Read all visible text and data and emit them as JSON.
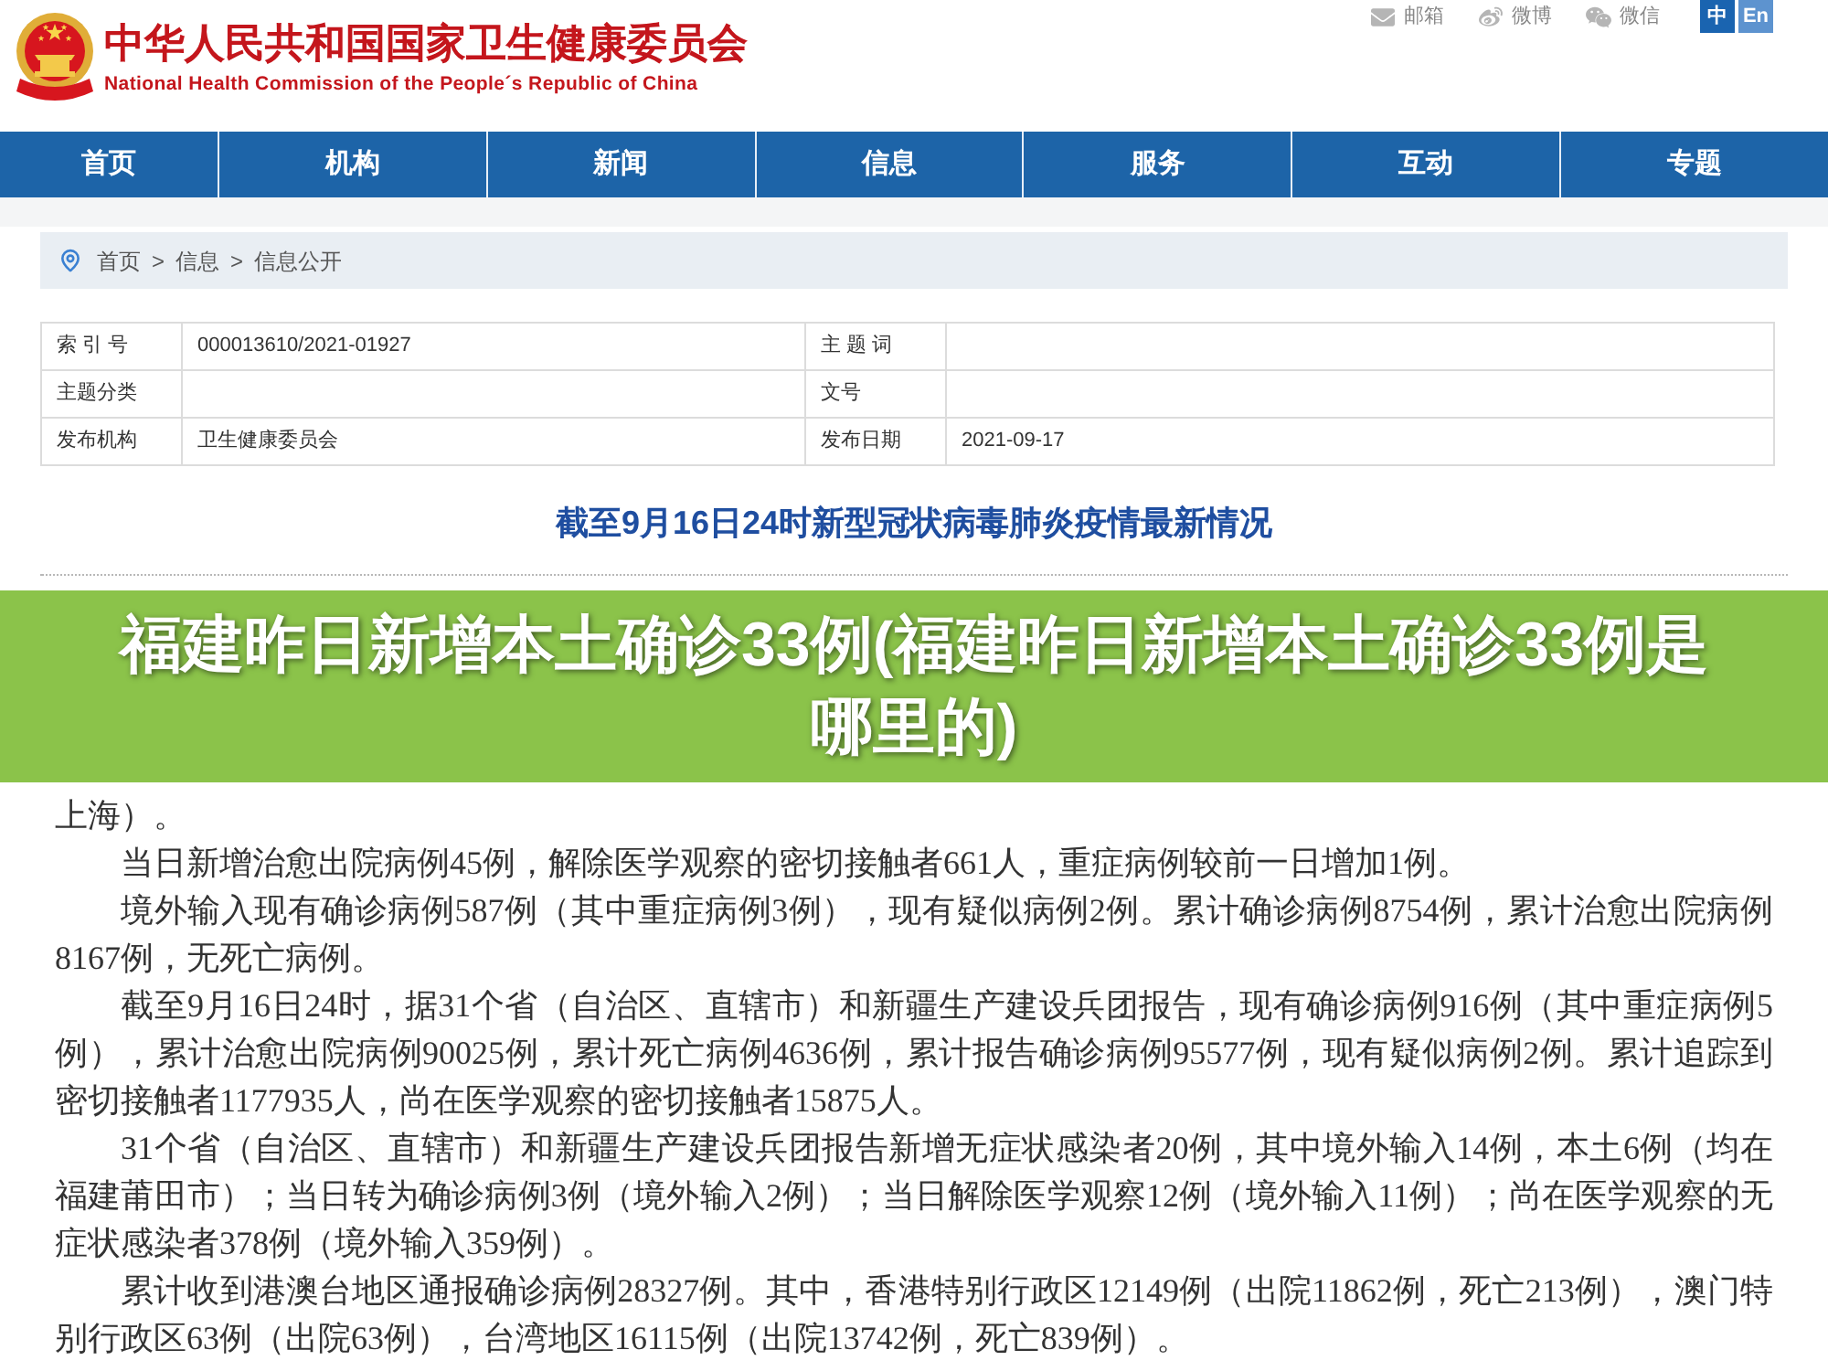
{
  "header": {
    "title": "中华人民共和国国家卫生健康委员会",
    "subtitle": "National Health Commission of the People´s Republic of China",
    "links": [
      {
        "kind": "mail",
        "label": "邮箱"
      },
      {
        "kind": "weibo",
        "label": "微博"
      },
      {
        "kind": "wechat",
        "label": "微信"
      }
    ],
    "languages": [
      {
        "label": "中",
        "selected": true
      },
      {
        "label": "En",
        "selected": false
      }
    ]
  },
  "nav": {
    "items": [
      "首页",
      "机构",
      "新闻",
      "信息",
      "服务",
      "互动",
      "专题"
    ]
  },
  "breadcrumb": {
    "items": [
      {
        "kind": "link",
        "text": "首页"
      },
      {
        "kind": "separator",
        "text": ">"
      },
      {
        "kind": "link",
        "text": "信息"
      },
      {
        "kind": "separator",
        "text": ">"
      },
      {
        "kind": "link",
        "text": "信息公开"
      }
    ]
  },
  "metadata": {
    "rows": [
      {
        "label_1": "索 引 号",
        "value_1": "000013610/2021-01927",
        "label_2": "主 题 词"
      },
      {
        "label_1": "主题分类",
        "label_2": "文号"
      },
      {
        "label_1": "发布机构",
        "value_1": "卫生健康委员会",
        "label_2": "发布日期",
        "value_2": "2021-09-17"
      }
    ]
  },
  "article": {
    "title": "截至9月16日24时新型冠状病毒肺炎疫情最新情况"
  },
  "banner": {
    "text": "福建昨日新增本土确诊33例(福建昨日新增本土确诊33例是哪里的)"
  },
  "body": {
    "paragraphs": [
      {
        "kind": "continuation",
        "text": "上海）。"
      },
      {
        "kind": "paragraph",
        "text": "当日新增治愈出院病例45例，解除医学观察的密切接触者661人，重症病例较前一日增加1例。"
      },
      {
        "kind": "paragraph",
        "text": "境外输入现有确诊病例587例（其中重症病例3例），现有疑似病例2例。累计确诊病例8754例，累计治愈出院病例8167例，无死亡病例。"
      },
      {
        "kind": "paragraph",
        "text": "截至9月16日24时，据31个省（自治区、直辖市）和新疆生产建设兵团报告，现有确诊病例916例（其中重症病例5例），累计治愈出院病例90025例，累计死亡病例4636例，累计报告确诊病例95577例，现有疑似病例2例。累计追踪到密切接触者1177935人，尚在医学观察的密切接触者15875人。"
      },
      {
        "kind": "paragraph",
        "text": "31个省（自治区、直辖市）和新疆生产建设兵团报告新增无症状感染者20例，其中境外输入14例，本土6例（均在福建莆田市）；当日转为确诊病例3例（境外输入2例）；当日解除医学观察12例（境外输入11例）；尚在医学观察的无症状感染者378例（境外输入359例）。"
      },
      {
        "kind": "paragraph",
        "text": "累计收到港澳台地区通报确诊病例28327例。其中，香港特别行政区12149例（出院11862例，死亡213例），澳门特别行政区63例（出院63例），台湾地区16115例（出院13742例，死亡839例）。"
      }
    ]
  }
}
